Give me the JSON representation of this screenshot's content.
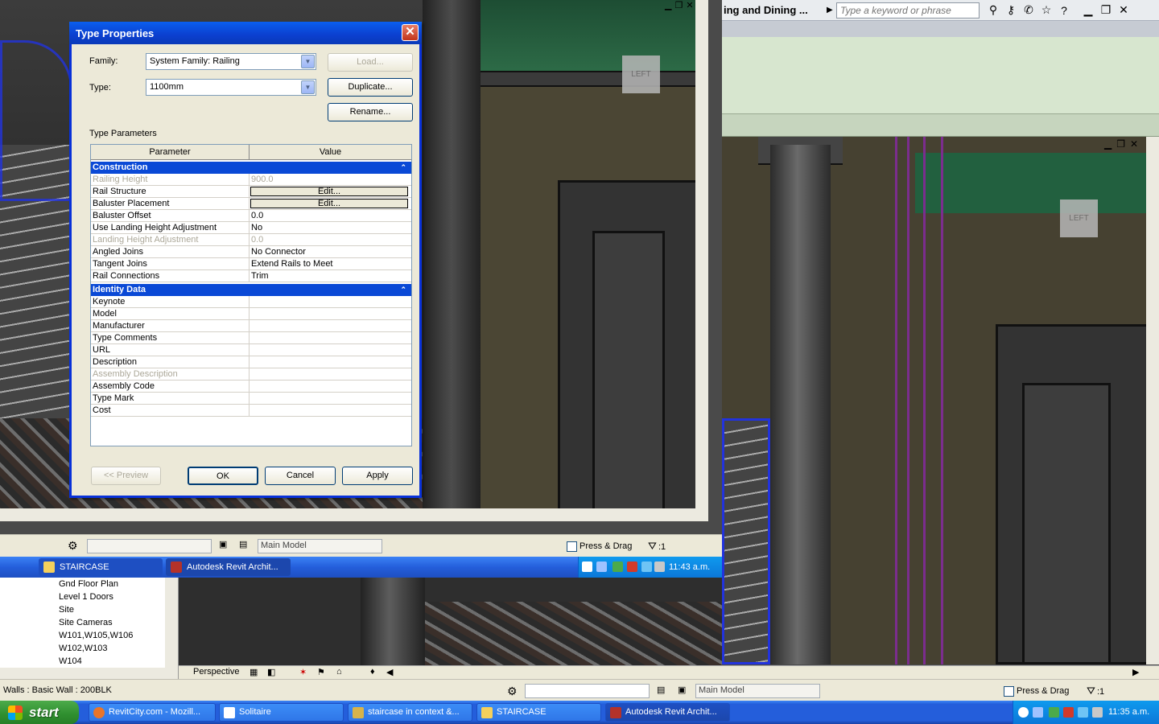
{
  "dialog": {
    "title": "Type Properties",
    "family_label": "Family:",
    "family_value": "System Family: Railing",
    "type_label": "Type:",
    "type_value": "1100mm",
    "load_label": "Load...",
    "duplicate_label": "Duplicate...",
    "rename_label": "Rename...",
    "type_parameters_label": "Type Parameters",
    "col_parameter": "Parameter",
    "col_value": "Value",
    "groups": [
      {
        "name": "Construction",
        "rows": [
          {
            "param": "Railing Height",
            "value": "900.0",
            "disabled": true
          },
          {
            "param": "Rail Structure",
            "value": "Edit...",
            "button": true
          },
          {
            "param": "Baluster Placement",
            "value": "Edit...",
            "button": true
          },
          {
            "param": "Baluster Offset",
            "value": "0.0"
          },
          {
            "param": "Use Landing Height Adjustment",
            "value": "No"
          },
          {
            "param": "Landing Height Adjustment",
            "value": "0.0",
            "disabled": true
          },
          {
            "param": "Angled Joins",
            "value": "No Connector"
          },
          {
            "param": "Tangent Joins",
            "value": "Extend Rails to Meet"
          },
          {
            "param": "Rail Connections",
            "value": "Trim"
          }
        ]
      },
      {
        "name": "Identity Data",
        "rows": [
          {
            "param": "Keynote",
            "value": ""
          },
          {
            "param": "Model",
            "value": ""
          },
          {
            "param": "Manufacturer",
            "value": ""
          },
          {
            "param": "Type Comments",
            "value": ""
          },
          {
            "param": "URL",
            "value": ""
          },
          {
            "param": "Description",
            "value": ""
          },
          {
            "param": "Assembly Description",
            "value": "",
            "disabled": true
          },
          {
            "param": "Assembly Code",
            "value": ""
          },
          {
            "param": "Type Mark",
            "value": ""
          },
          {
            "param": "Cost",
            "value": ""
          }
        ]
      }
    ],
    "preview_label": "<< Preview",
    "ok_label": "OK",
    "cancel_label": "Cancel",
    "apply_label": "Apply",
    "close_icon": "close-icon",
    "collapse_icon": "chevron-up-icon"
  },
  "right_window": {
    "doc_title": "ing and Dining ...",
    "search_placeholder": "Type a keyword or phrase",
    "viewcube_label": "LEFT"
  },
  "left_view": {
    "viewcube_label": "LEFT",
    "workset": "Main Model",
    "press_drag": "Press & Drag",
    "filter_count": ":1"
  },
  "inner_taskbar": {
    "items": [
      "STAIRCASE",
      "Autodesk Revit Archit..."
    ],
    "time": "11:43 a.m."
  },
  "project_browser": {
    "items": [
      "Gnd Floor Plan",
      "Level 1 Doors",
      "Site",
      "Site Cameras",
      "W101,W105,W106",
      "W102,W103",
      "W104"
    ]
  },
  "view_bar": {
    "view_type": "Perspective"
  },
  "status_bar": {
    "text": "Walls : Basic Wall : 200BLK",
    "workset": "Main Model",
    "press_drag": "Press & Drag",
    "filter_count": ":1"
  },
  "xp_taskbar": {
    "start_label": "start",
    "items": [
      "RevitCity.com - Mozill...",
      "Solitaire",
      "staircase in context &...",
      "STAIRCASE",
      "Autodesk Revit Archit..."
    ],
    "time": "11:35 a.m."
  },
  "colors": {
    "dialog_blue": "#0a49d6",
    "xp_taskbar": "#245edb",
    "start_green": "#2f8f2f"
  }
}
